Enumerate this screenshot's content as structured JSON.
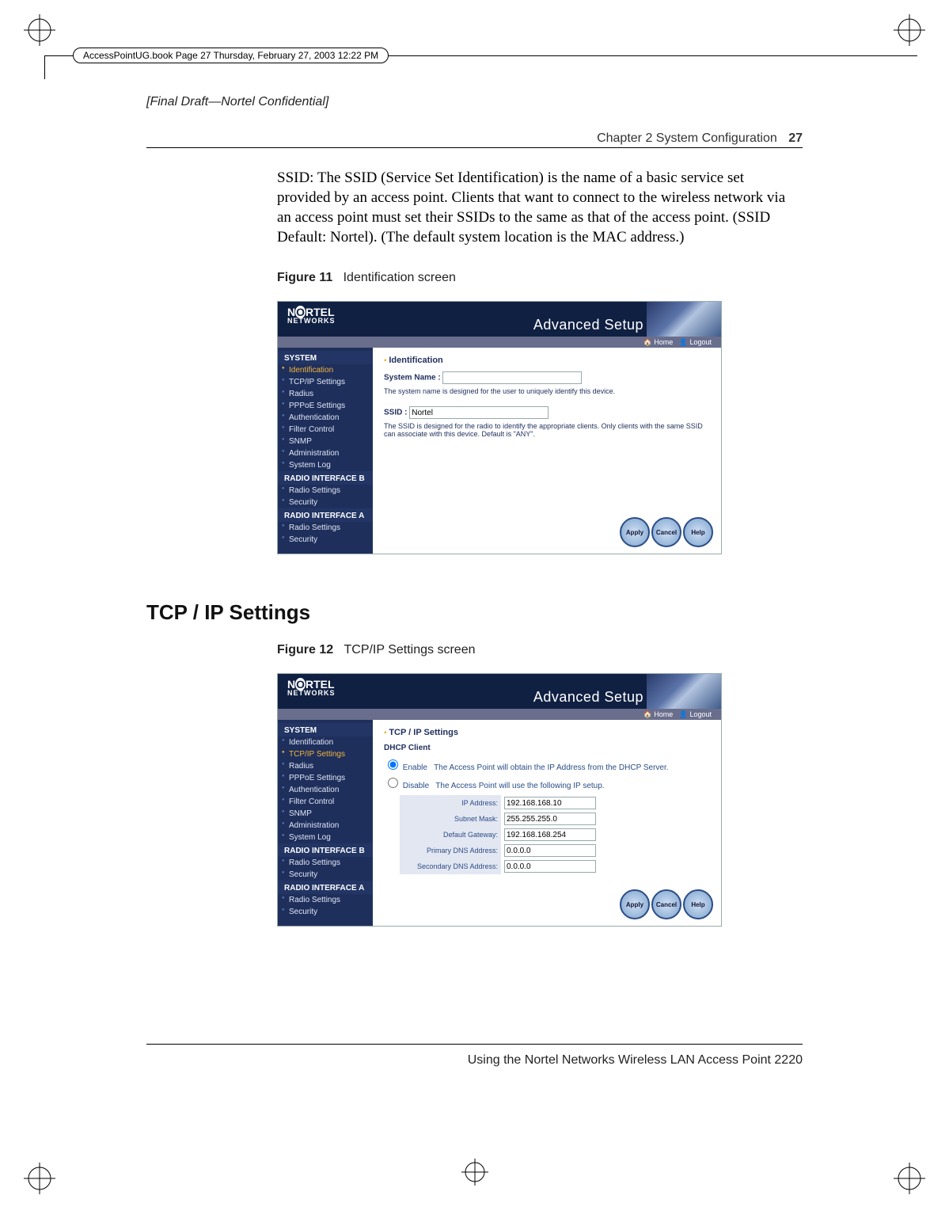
{
  "frame_info": "AccessPointUG.book  Page 27  Thursday, February 27, 2003  12:22 PM",
  "draft_note": "[Final Draft—Nortel Confidential]",
  "chapter_label": "Chapter 2  System Configuration",
  "page_number": "27",
  "body_ssid": "SSID: The SSID (Service Set Identification) is the name of a basic service set provided by an access point. Clients that want to connect to the wireless network via an access point must set their SSIDs to the same as that of the access point. (SSID Default: Nortel). (The default system location is the MAC address.)",
  "fig11": {
    "label": "Figure 11",
    "caption": "Identification screen"
  },
  "section_heading": "TCP / IP Settings",
  "fig12": {
    "label": "Figure 12",
    "caption": "TCP/IP Settings screen"
  },
  "footer": "Using the Nortel Networks Wireless LAN Access Point 2220",
  "ss_common": {
    "brand_line1": "NORTEL",
    "brand_line2": "NETWORKS",
    "adv_setup": "Advanced Setup",
    "link_home": "Home",
    "link_logout": "Logout",
    "side": {
      "system": "SYSTEM",
      "items": [
        "Identification",
        "TCP/IP Settings",
        "Radius",
        "PPPoE Settings",
        "Authentication",
        "Filter Control",
        "SNMP",
        "Administration",
        "System Log"
      ],
      "radio_b": "RADIO INTERFACE B",
      "radio_a": "RADIO INTERFACE A",
      "sub": [
        "Radio Settings",
        "Security"
      ]
    },
    "buttons": {
      "apply": "Apply",
      "cancel": "Cancel",
      "help": "Help"
    }
  },
  "ss1": {
    "title": "Identification",
    "sysname_label": "System Name :",
    "sysname_value": "",
    "sysname_help": "The system name is designed for the user to uniquely identify this device.",
    "ssid_label": "SSID :",
    "ssid_value": "Nortel",
    "ssid_help": "The SSID is designed for the radio to identify the appropriate clients. Only clients with the same SSID can associate with this device. Default is \"ANY\"."
  },
  "ss2": {
    "title": "TCP / IP Settings",
    "dhcp_title": "DHCP Client",
    "enable_label": "Enable",
    "enable_help": "The Access Point will obtain the IP Address from the DHCP Server.",
    "disable_label": "Disable",
    "disable_help": "The Access Point will use the following IP setup.",
    "rows": {
      "ip_k": "IP Address:",
      "ip_v": "192.168.168.10",
      "mask_k": "Subnet Mask:",
      "mask_v": "255.255.255.0",
      "gw_k": "Default Gateway:",
      "gw_v": "192.168.168.254",
      "pdns_k": "Primary DNS Address:",
      "pdns_v": "0.0.0.0",
      "sdns_k": "Secondary DNS Address:",
      "sdns_v": "0.0.0.0"
    }
  }
}
